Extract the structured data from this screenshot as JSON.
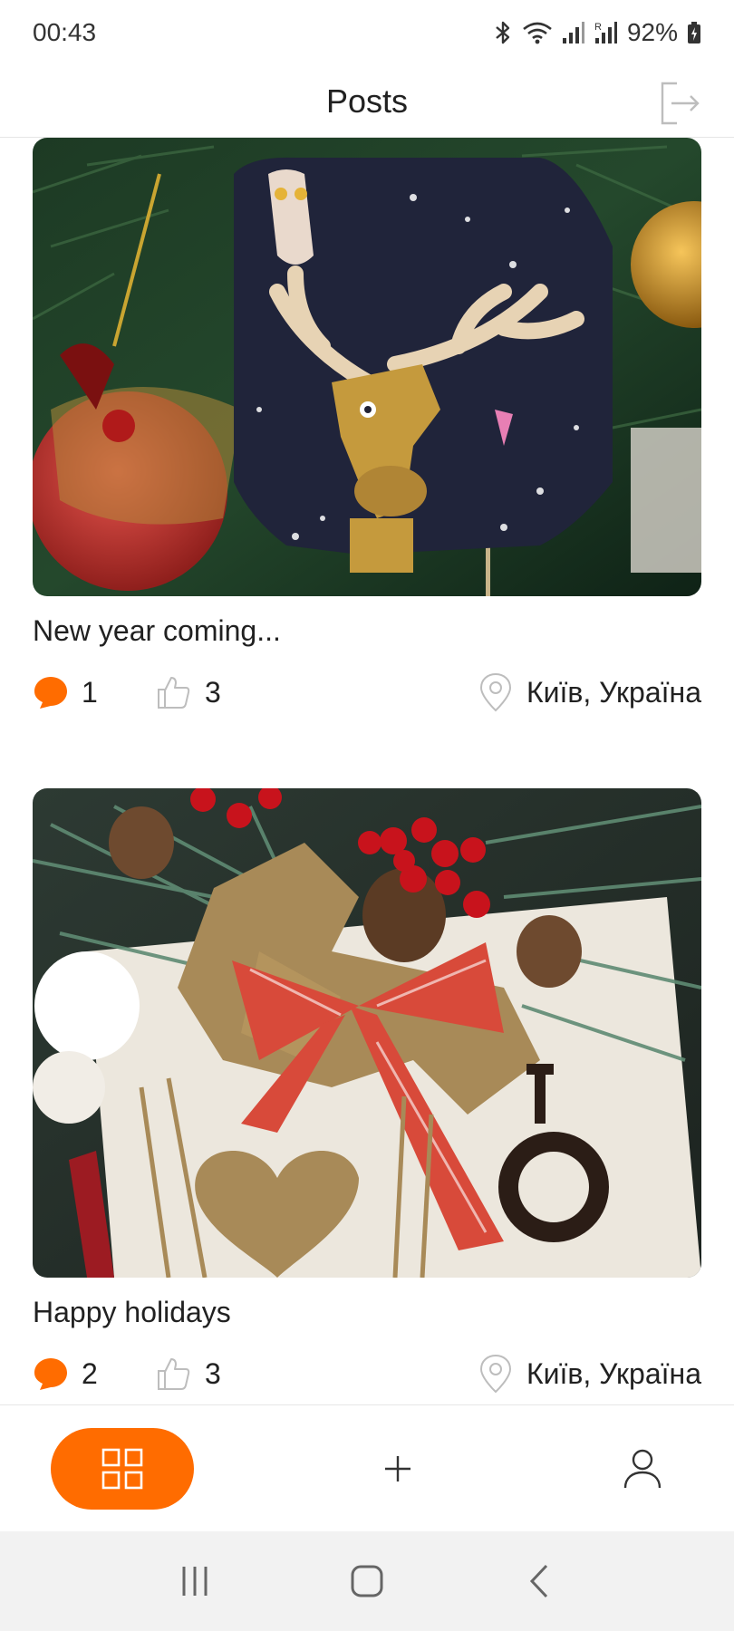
{
  "status_bar": {
    "time": "00:43",
    "battery": "92%"
  },
  "header": {
    "title": "Posts"
  },
  "posts": [
    {
      "title": "New year coming...",
      "comments": "1",
      "likes": "3",
      "location": "Київ, Україна"
    },
    {
      "title": "Happy holidays",
      "comments": "2",
      "likes": "3",
      "location": "Київ, Україна"
    }
  ],
  "colors": {
    "accent": "#ff6c00",
    "text": "#212121",
    "icon_gray": "#bdbdbd"
  },
  "icons": {
    "logout": "logout-icon",
    "comment": "comment-icon",
    "like": "like-icon",
    "location": "map-pin-icon",
    "grid": "grid-icon",
    "plus": "plus-icon",
    "user": "user-icon"
  }
}
